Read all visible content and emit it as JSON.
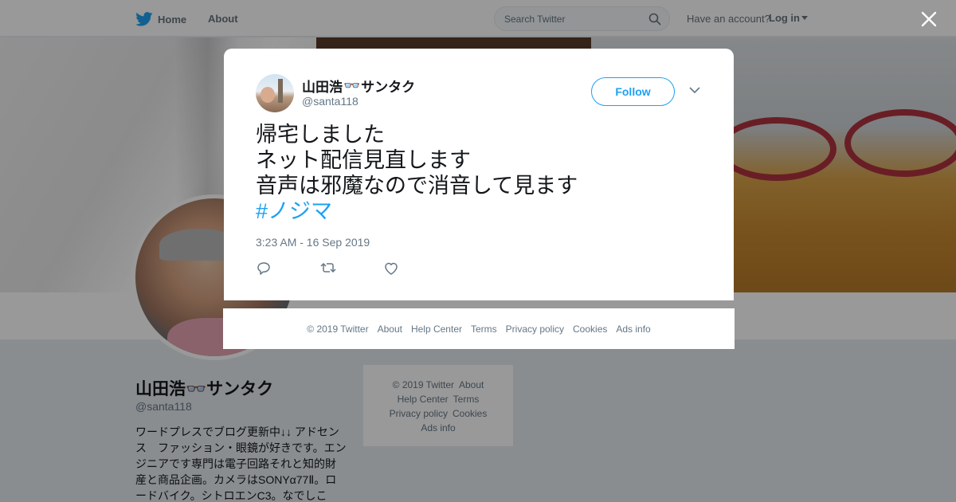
{
  "topbar": {
    "home_label": "Home",
    "about_label": "About",
    "search_placeholder": "Search Twitter",
    "have_account": "Have an account?",
    "login_label": "Log in"
  },
  "profile": {
    "name": "山田浩👓サンタク",
    "handle": "@santa118",
    "bio": "ワードプレスでブログ更新中↓↓ アドセンス　ファッション・眼鏡が好きです。エンジニアです専門は電子回路それと知的財産と商品企画。カメラはSONYα77Ⅱ。ロードバイク。シトロエンC3。なでしこ"
  },
  "side_footer": {
    "copyright": "© 2019 Twitter",
    "about": "About",
    "help": "Help Center",
    "terms": "Terms",
    "privacy": "Privacy policy",
    "cookies": "Cookies",
    "ads": "Ads info"
  },
  "tweet": {
    "author_name": "山田浩",
    "author_emoji": "👓",
    "author_name_suffix": "サンタク",
    "author_handle": "@santa118",
    "follow_label": "Follow",
    "lines": [
      "帰宅しました",
      "ネット配信見直します",
      "音声は邪魔なので消音して見ます"
    ],
    "hashtag": "#ノジマ",
    "timestamp": "3:23 AM - 16 Sep 2019"
  },
  "modal_footer": {
    "copyright": "© 2019 Twitter",
    "about": "About",
    "help": "Help Center",
    "terms": "Terms",
    "privacy": "Privacy policy",
    "cookies": "Cookies",
    "ads": "Ads info"
  },
  "colors": {
    "accent": "#1da1f2",
    "muted": "#657786",
    "text": "#14171a"
  },
  "icons": [
    "twitter-bird-icon",
    "search-icon",
    "caret-down-icon",
    "close-icon",
    "chevron-down-icon",
    "reply-icon",
    "retweet-icon",
    "like-icon"
  ]
}
